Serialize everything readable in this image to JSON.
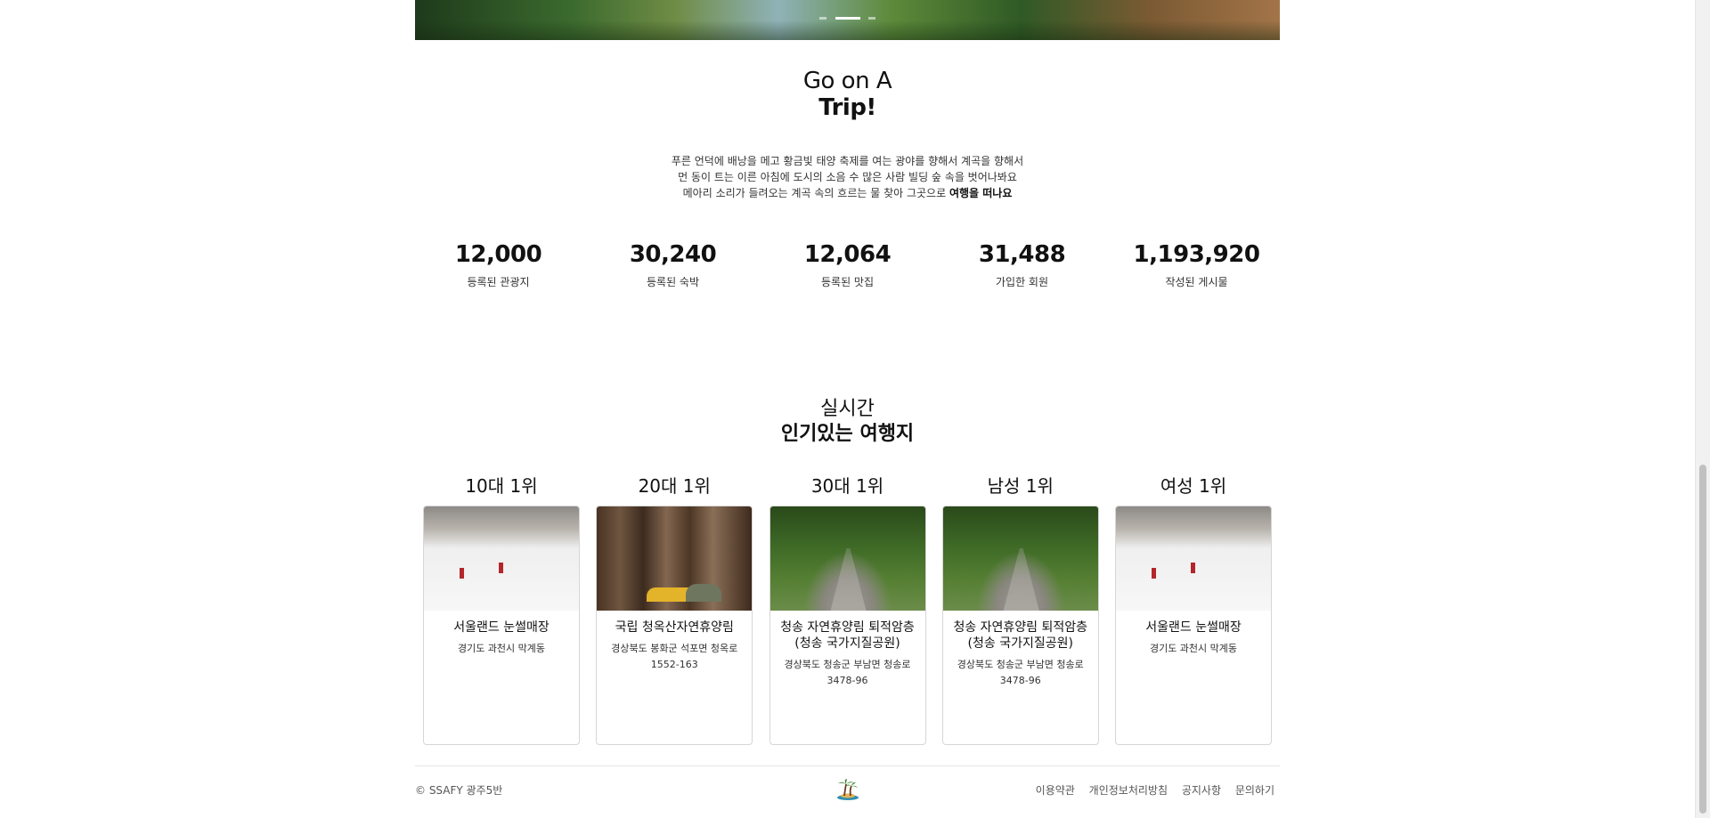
{
  "hero": {
    "dots": [
      "",
      "active",
      ""
    ]
  },
  "intro": {
    "title_line1": "Go on A",
    "title_line2": "Trip!",
    "text_line1": "푸른 언덕에 배낭을 메고 황금빛 태양 축제를 여는 광야를 향해서 계곡을 향해서",
    "text_line2": "먼 동이 트는 이른 아침에 도시의 소음 수 많은 사람 빌딩 숲 속을 벗어나봐요",
    "text_line3_prefix": "메아리 소리가 들려오는 계곡 속의 흐르는 물 찾아 그곳으로 ",
    "text_line3_bold": "여행을 떠나요"
  },
  "stats": [
    {
      "number": "12,000",
      "label": "등록된 관광지"
    },
    {
      "number": "30,240",
      "label": "등록된 숙박"
    },
    {
      "number": "12,064",
      "label": "등록된 맛집"
    },
    {
      "number": "31,488",
      "label": "가입한 회원"
    },
    {
      "number": "1,193,920",
      "label": "작성된 게시물"
    }
  ],
  "popular": {
    "title_line1": "실시간",
    "title_line2": "인기있는 여행지",
    "items": [
      {
        "rank": "10대 1위",
        "title": "서울랜드 눈썰매장",
        "address": "경기도 과천시 막계동",
        "image": "snow-slope"
      },
      {
        "rank": "20대 1위",
        "title": "국립 청옥산자연휴양림",
        "address": "경상북도 봉화군 석포면 청옥로 1552-163",
        "image": "forest-camp"
      },
      {
        "rank": "30대 1위",
        "title": "청송 자연휴양림 퇴적암층 (청송 국가지질공원)",
        "address": "경상북도 청송군 부남면 청송로 3478-96",
        "image": "forest-road"
      },
      {
        "rank": "남성 1위",
        "title": "청송 자연휴양림 퇴적암층 (청송 국가지질공원)",
        "address": "경상북도 청송군 부남면 청송로 3478-96",
        "image": "forest-road"
      },
      {
        "rank": "여성 1위",
        "title": "서울랜드 눈썰매장",
        "address": "경기도 과천시 막계동",
        "image": "snow-slope"
      }
    ]
  },
  "footer": {
    "copyright": "© SSAFY 광주5반",
    "logo_icon": "palm-island-icon",
    "links": [
      "이용약관",
      "개인정보처리방침",
      "공지사항",
      "문의하기"
    ]
  }
}
